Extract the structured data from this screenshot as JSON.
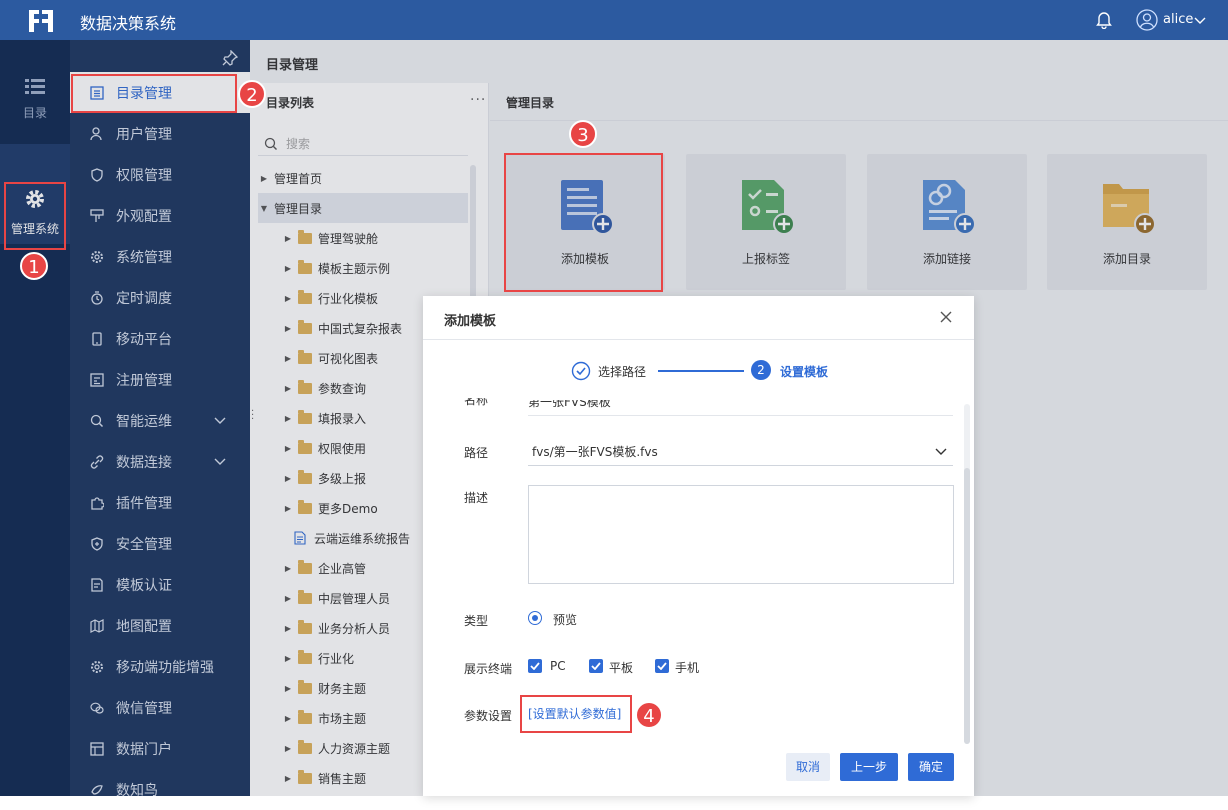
{
  "app": {
    "title": "数据决策系统",
    "user": "alice"
  },
  "rail": {
    "items": [
      {
        "label": "目录"
      },
      {
        "label": "管理系统"
      }
    ]
  },
  "sidebar": {
    "items": [
      {
        "label": "目录管理",
        "icon": "catalog-icon"
      },
      {
        "label": "用户管理",
        "icon": "user-icon"
      },
      {
        "label": "权限管理",
        "icon": "shield-icon"
      },
      {
        "label": "外观配置",
        "icon": "brush-icon"
      },
      {
        "label": "系统管理",
        "icon": "gear-icon"
      },
      {
        "label": "定时调度",
        "icon": "timer-icon"
      },
      {
        "label": "移动平台",
        "icon": "mobile-icon"
      },
      {
        "label": "注册管理",
        "icon": "register-icon"
      },
      {
        "label": "智能运维",
        "icon": "ops-icon"
      },
      {
        "label": "数据连接",
        "icon": "link-icon"
      },
      {
        "label": "插件管理",
        "icon": "plugin-icon"
      },
      {
        "label": "安全管理",
        "icon": "security-icon"
      },
      {
        "label": "模板认证",
        "icon": "cert-icon"
      },
      {
        "label": "地图配置",
        "icon": "map-icon"
      },
      {
        "label": "移动端功能增强",
        "icon": "gear-icon"
      },
      {
        "label": "微信管理",
        "icon": "wechat-icon"
      },
      {
        "label": "数据门户",
        "icon": "portal-icon"
      },
      {
        "label": "数知鸟",
        "icon": "bird-icon"
      }
    ]
  },
  "breadcrumb": "目录管理",
  "tree": {
    "title": "目录列表",
    "search_placeholder": "搜索",
    "rows": [
      {
        "label": "管理首页",
        "type": "root"
      },
      {
        "label": "管理目录",
        "type": "root-open"
      },
      {
        "label": "管理驾驶舱",
        "type": "folder"
      },
      {
        "label": "模板主题示例",
        "type": "folder"
      },
      {
        "label": "行业化模板",
        "type": "folder"
      },
      {
        "label": "中国式复杂报表",
        "type": "folder"
      },
      {
        "label": "可视化图表",
        "type": "folder"
      },
      {
        "label": "参数查询",
        "type": "folder"
      },
      {
        "label": "填报录入",
        "type": "folder"
      },
      {
        "label": "权限使用",
        "type": "folder"
      },
      {
        "label": "多级上报",
        "type": "folder"
      },
      {
        "label": "更多Demo",
        "type": "folder"
      },
      {
        "label": "云端运维系统报告",
        "type": "file"
      },
      {
        "label": "企业高管",
        "type": "folder"
      },
      {
        "label": "中层管理人员",
        "type": "folder"
      },
      {
        "label": "业务分析人员",
        "type": "folder"
      },
      {
        "label": "行业化",
        "type": "folder"
      },
      {
        "label": "财务主题",
        "type": "folder"
      },
      {
        "label": "市场主题",
        "type": "folder"
      },
      {
        "label": "人力资源主题",
        "type": "folder"
      },
      {
        "label": "销售主题",
        "type": "folder"
      }
    ]
  },
  "manage": {
    "title": "管理目录",
    "cards": [
      {
        "label": "添加模板"
      },
      {
        "label": "上报标签"
      },
      {
        "label": "添加链接"
      },
      {
        "label": "添加目录"
      }
    ]
  },
  "modal": {
    "title": "添加模板",
    "step1": "选择路径",
    "step2_num": "2",
    "step2": "设置模板",
    "name_label": "名称",
    "name_value": "第一张FVS模板",
    "path_label": "路径",
    "path_value": "fvs/第一张FVS模板.fvs",
    "desc_label": "描述",
    "type_label": "类型",
    "type_value": "预览",
    "terminal_label": "展示终端",
    "terminals": [
      "PC",
      "平板",
      "手机"
    ],
    "param_label": "参数设置",
    "param_link": "[设置默认参数值]",
    "cancel": "取消",
    "prev": "上一步",
    "ok": "确定"
  },
  "badges": [
    "1",
    "2",
    "3",
    "4"
  ]
}
